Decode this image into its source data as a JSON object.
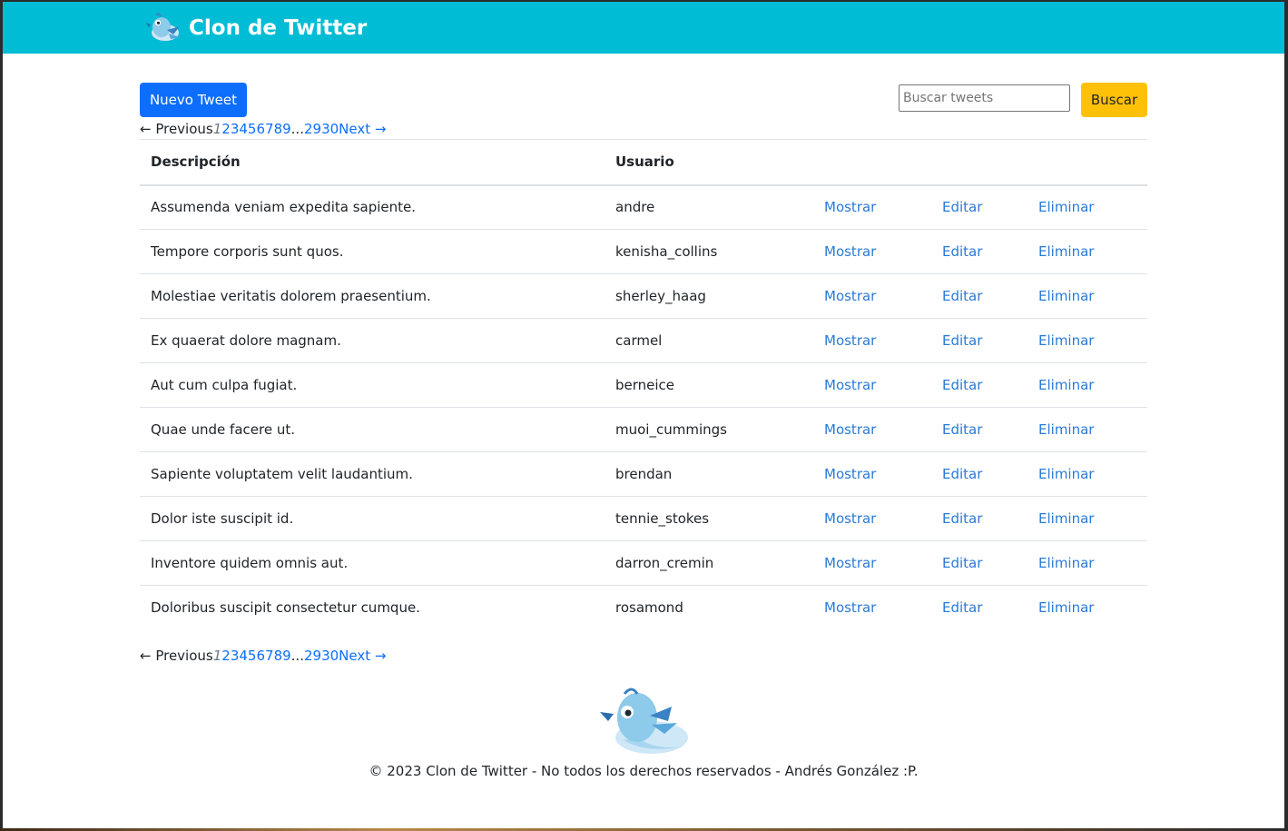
{
  "navbar": {
    "brand_text": "Clon de Twitter",
    "color": "#00bcd4"
  },
  "toolbar": {
    "new_tweet_label": "Nuevo Tweet",
    "search_placeholder": "Buscar tweets",
    "search_value": "",
    "search_button_label": "Buscar"
  },
  "pagination": {
    "prev_label": "← Previous",
    "current_page": "1",
    "pages": [
      "2",
      "3",
      "4",
      "5",
      "6",
      "7",
      "8",
      "9"
    ],
    "ellipsis": "...",
    "last_pages": [
      "29",
      "30"
    ],
    "next_label": "Next →"
  },
  "table": {
    "headers": {
      "description": "Descripción",
      "user": "Usuario"
    },
    "action_labels": {
      "show": "Mostrar",
      "edit": "Editar",
      "delete": "Eliminar"
    },
    "rows": [
      {
        "description": "Assumenda veniam expedita sapiente.",
        "user": "andre"
      },
      {
        "description": "Tempore corporis sunt quos.",
        "user": "kenisha_collins"
      },
      {
        "description": "Molestiae veritatis dolorem praesentium.",
        "user": "sherley_haag"
      },
      {
        "description": "Ex quaerat dolore magnam.",
        "user": "carmel"
      },
      {
        "description": "Aut cum culpa fugiat.",
        "user": "berneice"
      },
      {
        "description": "Quae unde facere ut.",
        "user": "muoi_cummings"
      },
      {
        "description": "Sapiente voluptatem velit laudantium.",
        "user": "brendan"
      },
      {
        "description": "Dolor iste suscipit id.",
        "user": "tennie_stokes"
      },
      {
        "description": "Inventore quidem omnis aut.",
        "user": "darron_cremin"
      },
      {
        "description": "Doloribus suscipit consectetur cumque.",
        "user": "rosamond"
      }
    ]
  },
  "footer": {
    "text": "© 2023 Clon de Twitter - No todos los derechos reservados - Andrés González :P."
  },
  "colors": {
    "primary": "#0d6efd",
    "warning": "#ffc107",
    "link": "#2a7ad6"
  }
}
